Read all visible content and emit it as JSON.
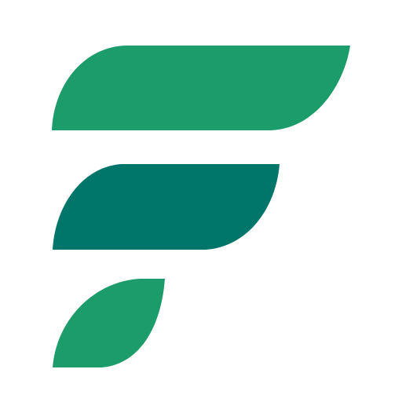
{
  "logo": {
    "icon": "leaf-f-logo-icon",
    "colors": {
      "leaf_light": "#1c9c6a",
      "leaf_dark": "#00756a",
      "background": "#ffffff"
    }
  }
}
